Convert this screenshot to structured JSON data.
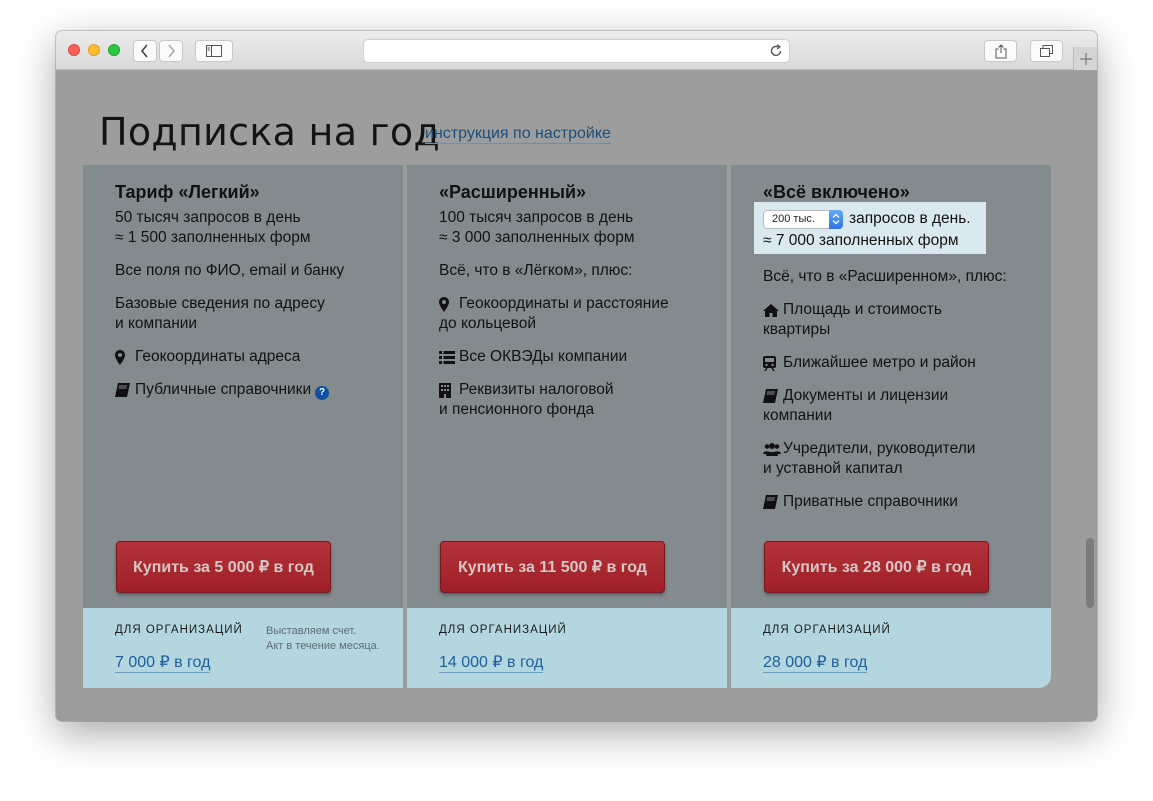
{
  "page": {
    "title": "Подписка на год",
    "setup_link": "инструкция по настройке"
  },
  "plans": [
    {
      "title": "Тариф «Легкий»",
      "line1": "50 тысяч запросов в день",
      "line2": "≈ 1 500 заполненных форм",
      "p1": "Все поля по ФИО, email и банку",
      "p2a": "Базовые сведения по адресу",
      "p2b": "и компании",
      "item1": "Геокоординаты адреса",
      "item2": "Публичные справочники",
      "buy_label": "Купить за 5 000 ₽ в год",
      "org_label": "ДЛЯ ОРГАНИЗАЦИЙ",
      "org_price": "7 000 ₽ в год",
      "org_note1": "Выставляем счет.",
      "org_note2": "Акт в течение месяца."
    },
    {
      "title": "«Расширенный»",
      "line1": "100 тысяч запросов в день",
      "line2": "≈ 3 000 заполненных форм",
      "p1": "Всё, что в «Лёгком», плюс:",
      "item1a": "Геокоординаты и расстояние",
      "item1b": "до кольцевой",
      "item2": "Все ОКВЭДы компании",
      "item3a": "Реквизиты налоговой",
      "item3b": "и пенсионного фонда",
      "buy_label": "Купить за 11 500 ₽ в год",
      "org_label": "ДЛЯ ОРГАНИЗАЦИЙ",
      "org_price": "14 000 ₽ в год"
    },
    {
      "title": "«Всё включено»",
      "select_value": "200 тыс.",
      "line1": "запросов в день.",
      "line2": "≈ 7 000 заполненных форм",
      "p1": "Всё, что в «Расширенном», плюс:",
      "item1a": "Площадь и стоимость",
      "item1b": "квартиры",
      "item2": "Ближайшее метро и район",
      "item3a": "Документы и лицензии",
      "item3b": "компании",
      "item4a": "Учредители, руководители",
      "item4b": "и уставной капитал",
      "item5": "Приватные справочники",
      "buy_label": "Купить за 28 000 ₽ в год",
      "org_label": "ДЛЯ ОРГАНИЗАЦИЙ",
      "org_price": "28 000 ₽ в год"
    }
  ],
  "icons": {
    "pin": "map-pin-icon",
    "book": "book-icon",
    "help": "question-icon",
    "list": "list-icon",
    "building": "building-icon",
    "home": "home-icon",
    "train": "train-icon",
    "users": "users-icon"
  },
  "help_glyph": "?",
  "colors": {
    "buy_button": "#a8262e",
    "footer": "#b3d6df",
    "link": "#1e5fa0"
  }
}
